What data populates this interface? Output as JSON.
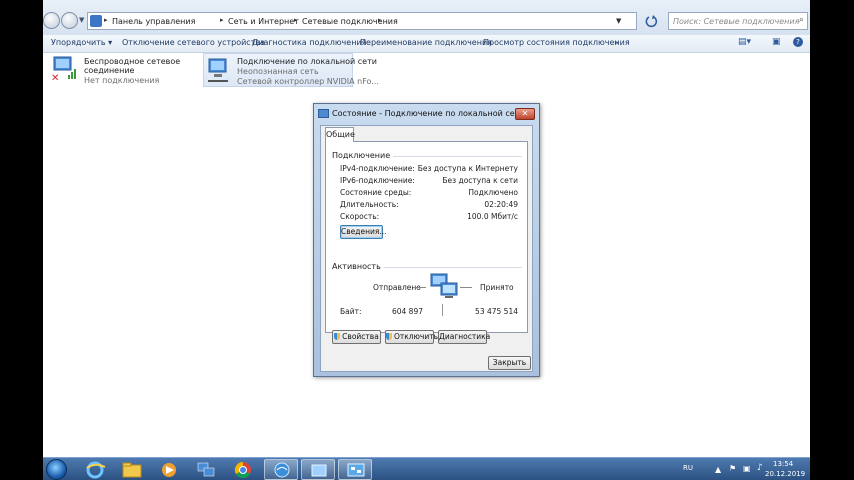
{
  "breadcrumb": [
    "Панель управления",
    "Сеть и Интернет",
    "Сетевые подключения"
  ],
  "search": {
    "placeholder": "Поиск: Сетевые подключения"
  },
  "toolbar": {
    "organize": "Упорядочить",
    "disable": "Отключение сетевого устройства",
    "diagnose": "Диагностика подключения",
    "rename": "Переименование подключения",
    "status": "Просмотр состояния подключения",
    "more": "»"
  },
  "connections": [
    {
      "name": "Беспроводное сетевое соединение",
      "status": "Нет подключения",
      "device": ""
    },
    {
      "name": "Подключение по локальной сети",
      "status": "Неопознанная сеть",
      "device": "Сетевой контроллер NVIDIA nFo..."
    }
  ],
  "dialog": {
    "title": "Состояние - Подключение по локальной сети",
    "tab": "Общие",
    "connection_group": "Подключение",
    "rows": [
      {
        "label": "IPv4-подключение:",
        "value": "Без доступа к Интернету"
      },
      {
        "label": "IPv6-подключение:",
        "value": "Без доступа к сети"
      },
      {
        "label": "Состояние среды:",
        "value": "Подключено"
      },
      {
        "label": "Длительность:",
        "value": "02:20:49"
      },
      {
        "label": "Скорость:",
        "value": "100.0 Мбит/с"
      }
    ],
    "details_button": "Сведения...",
    "activity_group": "Активность",
    "sent_label": "Отправлено",
    "received_label": "Принято",
    "bytes_label": "Байт:",
    "bytes_sent": "604 897",
    "bytes_received": "53 475 514",
    "properties_button": "Свойства",
    "disable_button": "Отключить",
    "diagnose_button": "Диагностика",
    "close_button": "Закрыть"
  },
  "tray": {
    "lang": "RU",
    "time": "13:54",
    "date": "20.12.2019"
  },
  "colors": {
    "accent": "#3d76c6",
    "taskbar": "#2a4f80",
    "close": "#c0432b"
  }
}
